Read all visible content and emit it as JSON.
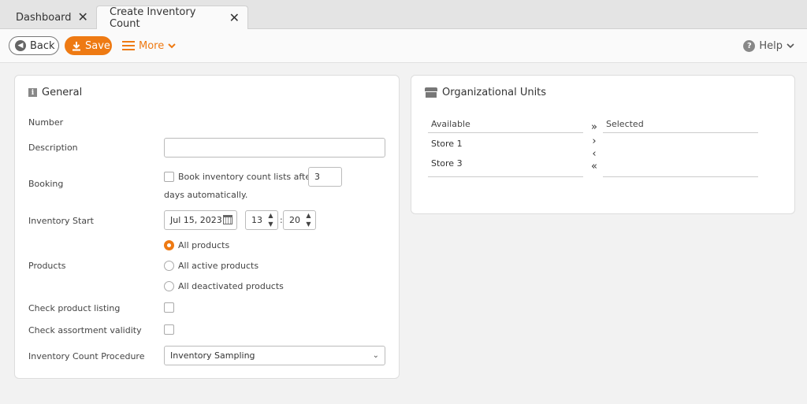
{
  "tabs": [
    {
      "label": "Dashboard",
      "active": false
    },
    {
      "label": "Create Inventory Count",
      "active": true
    }
  ],
  "toolbar": {
    "back_label": "Back",
    "save_label": "Save",
    "more_label": "More",
    "help_label": "Help",
    "accent_color": "#ee7a13"
  },
  "general": {
    "title": "General",
    "number_label": "Number",
    "description_label": "Description",
    "description_value": "",
    "booking_label": "Booking",
    "booking_checkbox_text": "Book inventory count lists after",
    "booking_days": "3",
    "booking_suffix": "days automatically.",
    "inventory_start_label": "Inventory Start",
    "start_date": "Jul 15, 2023",
    "start_hour": "13",
    "start_minute": "20",
    "time_separator": ":",
    "products_label": "Products",
    "products_options": [
      "All products",
      "All active products",
      "All deactivated products"
    ],
    "products_selected": "All products",
    "check_listing_label": "Check product listing",
    "check_assortment_label": "Check assortment validity",
    "procedure_label": "Inventory Count Procedure",
    "procedure_value": "Inventory Sampling"
  },
  "org_units": {
    "title": "Organizational Units",
    "available_label": "Available",
    "selected_label": "Selected",
    "available_items": [
      "Store 1",
      "Store 3"
    ],
    "selected_items": [],
    "move_all_right": "»",
    "move_right": "›",
    "move_left": "‹",
    "move_all_left": "«"
  }
}
